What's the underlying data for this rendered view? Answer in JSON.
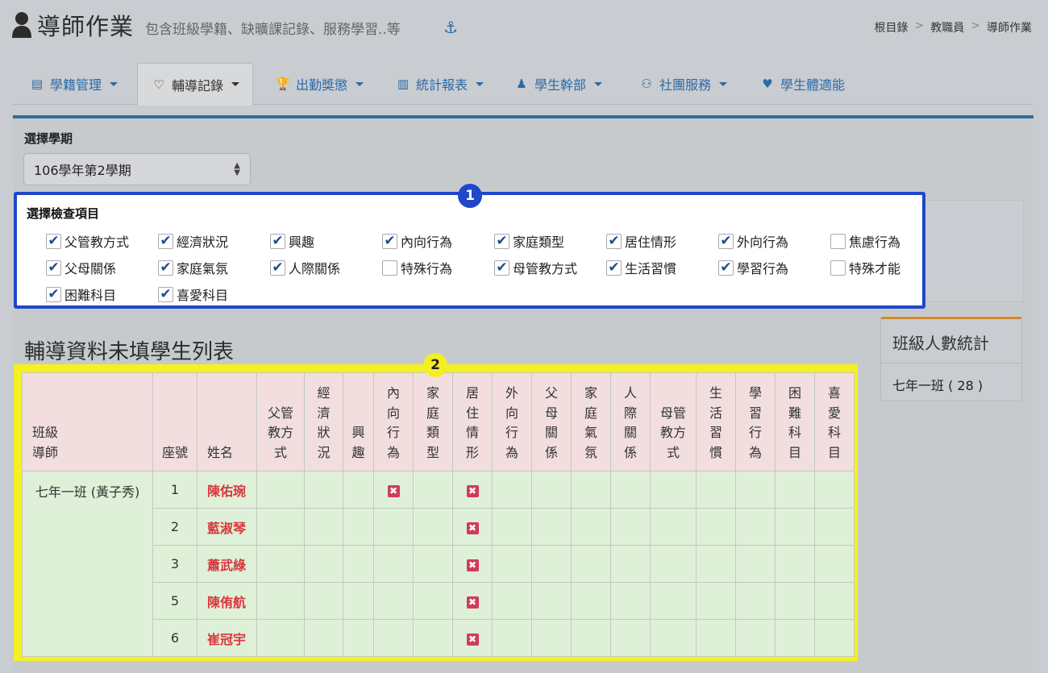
{
  "header": {
    "title": "導師作業",
    "subtitle": "包含班級學籍、缺曠課記錄、服務學習..等",
    "breadcrumbs": [
      "根目錄",
      "教職員",
      "導師作業"
    ]
  },
  "tabs": [
    {
      "label": "學籍管理",
      "icon": "id-card-icon",
      "dropdown": true
    },
    {
      "label": "輔導記錄",
      "icon": "heart-icon",
      "dropdown": true,
      "active": true
    },
    {
      "label": "出勤獎懲",
      "icon": "trophy-icon",
      "dropdown": true
    },
    {
      "label": "統計報表",
      "icon": "bar-chart-icon",
      "dropdown": true
    },
    {
      "label": "學生幹部",
      "icon": "person-icon",
      "dropdown": true
    },
    {
      "label": "社團服務",
      "icon": "group-icon",
      "dropdown": true
    },
    {
      "label": "學生體適能",
      "icon": "heartbeat-icon",
      "dropdown": false
    }
  ],
  "semester": {
    "label": "選擇學期",
    "selected": "106學年第2學期"
  },
  "check_items": {
    "label": "選擇檢查項目",
    "items": [
      {
        "label": "父管教方式",
        "checked": true
      },
      {
        "label": "經濟狀況",
        "checked": true
      },
      {
        "label": "興趣",
        "checked": true
      },
      {
        "label": "內向行為",
        "checked": true
      },
      {
        "label": "家庭類型",
        "checked": true
      },
      {
        "label": "居住情形",
        "checked": true
      },
      {
        "label": "外向行為",
        "checked": true
      },
      {
        "label": "焦慮行為",
        "checked": false
      },
      {
        "label": "父母關係",
        "checked": true
      },
      {
        "label": "家庭氣氛",
        "checked": true
      },
      {
        "label": "人際關係",
        "checked": true
      },
      {
        "label": "特殊行為",
        "checked": false
      },
      {
        "label": "母管教方式",
        "checked": true
      },
      {
        "label": "生活習慣",
        "checked": true
      },
      {
        "label": "學習行為",
        "checked": true
      },
      {
        "label": "特殊才能",
        "checked": false
      },
      {
        "label": "困難科目",
        "checked": true
      },
      {
        "label": "喜愛科目",
        "checked": true
      }
    ]
  },
  "badges": {
    "one": "1",
    "two": "2"
  },
  "list": {
    "title": "輔導資料未填學生列表",
    "columns": [
      "班級\n導師",
      "座號",
      "姓名",
      "父管\n教方\n式",
      "經\n濟\n狀\n況",
      "興\n趣",
      "內\n向\n行\n為",
      "家\n庭\n類\n型",
      "居\n住\n情\n形",
      "外\n向\n行\n為",
      "父\n母\n關\n係",
      "家\n庭\n氣\n氛",
      "人\n際\n關\n係",
      "母管\n教方\n式",
      "生\n活\n習\n慣",
      "學\n習\n行\n為",
      "困\n難\n科\n目",
      "喜\n愛\n科\n目"
    ],
    "class_teacher": "七年一班 (黃子秀)",
    "rows": [
      {
        "seat": "1",
        "name": "陳佑琬",
        "missing": [
          6,
          8
        ]
      },
      {
        "seat": "2",
        "name": "藍淑琴",
        "missing": [
          8
        ]
      },
      {
        "seat": "3",
        "name": "蕭武綠",
        "missing": [
          8
        ]
      },
      {
        "seat": "5",
        "name": "陳侑航",
        "missing": [
          8
        ]
      },
      {
        "seat": "6",
        "name": "崔冠宇",
        "missing": [
          8
        ]
      }
    ],
    "missing_mark": "✖"
  },
  "stats": {
    "title": "班級人數統計",
    "value": "七年一班 ( 28 )"
  },
  "colors": {
    "highlight_1": "#1f47c9",
    "highlight_2": "#f5f020",
    "accent": "#2a6aa8",
    "missing_name": "#d9363e"
  }
}
